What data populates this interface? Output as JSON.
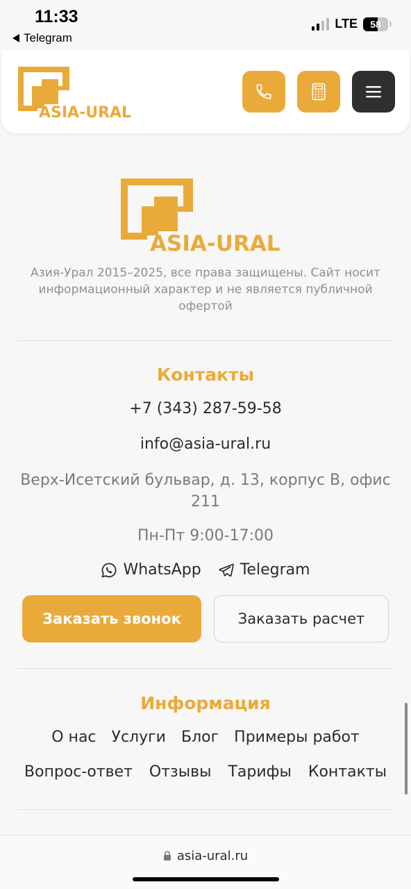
{
  "status_bar": {
    "time": "11:33",
    "back_app": "Telegram",
    "network": "LTE",
    "battery": "58",
    "battery_level": 0.58
  },
  "brand": {
    "name": "ASIA-URAL",
    "accent_color": "#eaaa3a",
    "dark_color": "#2f2f2f"
  },
  "header": {
    "icons": [
      "phone-icon",
      "calculator-icon",
      "menu-icon"
    ]
  },
  "footer": {
    "copyright": "Азия-Урал 2015–2025, все права защищены. Сайт носит информационный характер и не является публичной офертой"
  },
  "contacts": {
    "title": "Контакты",
    "phone": "+7 (343) 287-59-58",
    "email": "info@asia-ural.ru",
    "address": "Верх-Исетский бульвар, д. 13, корпус В, офис 211",
    "hours": "Пн-Пт 9:00-17:00",
    "whatsapp": "WhatsApp",
    "telegram": "Telegram",
    "order_call": "Заказать звонок",
    "order_calc": "Заказать расчет"
  },
  "information": {
    "title": "Информация",
    "row1": [
      {
        "label": "О нас"
      },
      {
        "label": "Услуги"
      },
      {
        "label": "Блог"
      },
      {
        "label": "Примеры работ"
      }
    ],
    "row2": [
      {
        "label": "Вопрос-ответ"
      },
      {
        "label": "Отзывы"
      },
      {
        "label": "Тарифы"
      },
      {
        "label": "Контакты"
      }
    ]
  },
  "browser": {
    "url": "asia-ural.ru"
  }
}
